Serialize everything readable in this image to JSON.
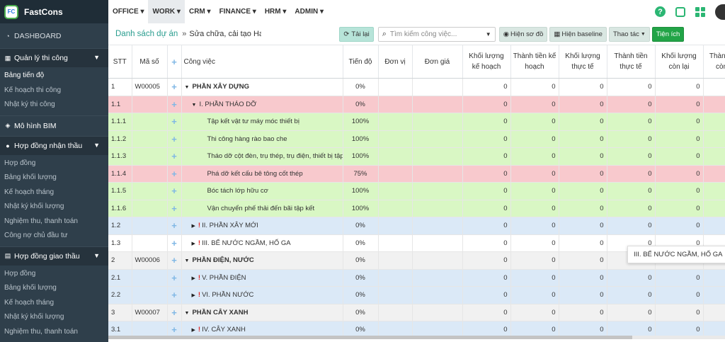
{
  "brand": {
    "name": "FastCons",
    "logo_text": "FC"
  },
  "sidebar": {
    "dashboard": "DASHBOARD",
    "group1": {
      "label": "Quản lý thi công",
      "items": [
        "Bảng tiến độ",
        "Kế hoạch thi công",
        "Nhật ký thi công"
      ]
    },
    "bim": "Mô hình BIM",
    "group2": {
      "label": "Hợp đồng nhận thầu",
      "items": [
        "Hợp đồng",
        "Bảng khối lượng",
        "Kế hoạch tháng",
        "Nhật ký khối lượng",
        "Nghiệm thu, thanh toán",
        "Công nợ chủ đầu tư"
      ]
    },
    "group3": {
      "label": "Hợp đồng giao thầu",
      "items": [
        "Hợp đồng",
        "Bảng khối lượng",
        "Kế hoạch tháng",
        "Nhật ký khối lượng",
        "Nghiệm thu, thanh toán"
      ]
    }
  },
  "topmenu": [
    "OFFICE",
    "WORK",
    "CRM",
    "FINANCE",
    "HRM",
    "ADMIN"
  ],
  "toolbar": {
    "breadcrumb_link": "Danh sách dự án",
    "breadcrumb_sep": "»",
    "breadcrumb_current": "Sửa chữa, cải tạo Ha",
    "reload": "Tải lại",
    "search_placeholder": "Tìm kiếm công việc...",
    "show_diagram": "Hiện sơ đồ",
    "show_baseline": "Hiện baseline",
    "actions": "Thao tác",
    "utility": "Tiện ích"
  },
  "grid": {
    "headers": [
      "STT",
      "Mã số",
      "+",
      "Công việc",
      "Tiến độ",
      "Đơn vị",
      "Đơn giá",
      "Khối lượng kế hoạch",
      "Thành tiền kế hoạch",
      "Khối lượng thực tế",
      "Thành tiền thực tế",
      "Khối lượng còn lại",
      "Thành tiền còn lại"
    ],
    "rows": [
      {
        "stt": "1",
        "code": "W00005",
        "task": "PHẦN XÂY DỰNG",
        "progress": "0%",
        "v": [
          "0",
          "0",
          "0",
          "0",
          "0"
        ]
      },
      {
        "stt": "1.1",
        "code": "",
        "task": "I. PHẦN THÁO DỠ",
        "progress": "0%",
        "v": [
          "0",
          "0",
          "0",
          "0",
          "0"
        ]
      },
      {
        "stt": "1.1.1",
        "code": "",
        "task": "Tập kết vật tư máy móc thiết bị",
        "progress": "100%",
        "v": [
          "0",
          "0",
          "0",
          "0",
          "0"
        ]
      },
      {
        "stt": "1.1.2",
        "code": "",
        "task": "Thi công hàng rào bao che",
        "progress": "100%",
        "v": [
          "0",
          "0",
          "0",
          "0",
          "0"
        ]
      },
      {
        "stt": "1.1.3",
        "code": "",
        "task": "Tháo dỡ cột đèn, trụ thép, trụ điện, thiết bị tập th",
        "progress": "100%",
        "v": [
          "0",
          "0",
          "0",
          "0",
          "0"
        ]
      },
      {
        "stt": "1.1.4",
        "code": "",
        "task": "Phá dỡ kết cấu bê tông cốt thép",
        "progress": "75%",
        "v": [
          "0",
          "0",
          "0",
          "0",
          "0"
        ]
      },
      {
        "stt": "1.1.5",
        "code": "",
        "task": "Bóc tách lớp hữu cơ",
        "progress": "100%",
        "v": [
          "0",
          "0",
          "0",
          "0",
          "0"
        ]
      },
      {
        "stt": "1.1.6",
        "code": "",
        "task": "Vận chuyển phế thải đến bãi tập kết",
        "progress": "100%",
        "v": [
          "0",
          "0",
          "0",
          "0",
          "0"
        ]
      },
      {
        "stt": "1.2",
        "code": "",
        "task": "II. PHẦN XÂY MỚI",
        "progress": "0%",
        "v": [
          "0",
          "0",
          "0",
          "0",
          "0"
        ]
      },
      {
        "stt": "1.3",
        "code": "",
        "task": "III. BỂ NƯỚC NGẦM, HỐ GA",
        "progress": "0%",
        "v": [
          "0",
          "0",
          "0",
          "0",
          "0"
        ]
      },
      {
        "stt": "2",
        "code": "W00006",
        "task": "PHẦN ĐIỆN, NƯỚC",
        "progress": "0%",
        "v": [
          "0",
          "0",
          "0",
          "0",
          "0"
        ]
      },
      {
        "stt": "2.1",
        "code": "",
        "task": "V. PHẦN ĐIỆN",
        "progress": "0%",
        "v": [
          "0",
          "0",
          "0",
          "0",
          "0"
        ]
      },
      {
        "stt": "2.2",
        "code": "",
        "task": "VI. PHẦN NƯỚC",
        "progress": "0%",
        "v": [
          "0",
          "0",
          "0",
          "0",
          "0"
        ]
      },
      {
        "stt": "3",
        "code": "W00007",
        "task": "PHẦN CÂY XANH",
        "progress": "0%",
        "v": [
          "0",
          "0",
          "0",
          "0",
          "0"
        ]
      },
      {
        "stt": "3.1",
        "code": "",
        "task": "IV. CÂY XANH",
        "progress": "0%",
        "v": [
          "0",
          "0",
          "0",
          "0",
          "0"
        ]
      }
    ]
  },
  "tooltip": "III. BỂ NƯỚC NGẦM, HỐ GA"
}
